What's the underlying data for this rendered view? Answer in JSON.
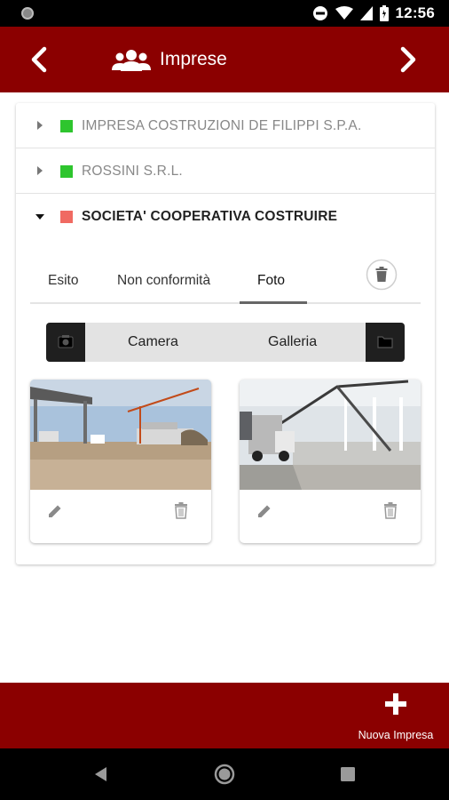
{
  "status_bar": {
    "time": "12:56"
  },
  "app_bar": {
    "title": "Imprese"
  },
  "companies": [
    {
      "name": "IMPRESA COSTRUZIONI DE FILIPPI S.P.A.",
      "status_color": "#2ec52e",
      "expanded": false
    },
    {
      "name": "ROSSINI S.R.L.",
      "status_color": "#2ec52e",
      "expanded": false
    },
    {
      "name": "SOCIETA' COOPERATIVA COSTRUIRE",
      "status_color": "#f06a62",
      "expanded": true
    }
  ],
  "tabs": [
    {
      "label": "Esito",
      "active": false
    },
    {
      "label": "Non conformità",
      "active": false
    },
    {
      "label": "Foto",
      "active": true
    }
  ],
  "photo_source": {
    "camera_label": "Camera",
    "gallery_label": "Galleria"
  },
  "photos": [
    {
      "subject": "construction-site-outdoor"
    },
    {
      "subject": "concrete-pouring-warehouse"
    }
  ],
  "footer": {
    "new_company_label": "Nuova Impresa"
  },
  "colors": {
    "brand": "#8b0000",
    "status_ok": "#2ec52e",
    "status_warn": "#f06a62"
  },
  "icons": [
    "prev-chevron-icon",
    "group-icon",
    "next-chevron-icon",
    "caret-right-icon",
    "caret-down-icon",
    "trash-icon",
    "camera-icon",
    "folder-icon",
    "pencil-icon",
    "plus-icon"
  ]
}
